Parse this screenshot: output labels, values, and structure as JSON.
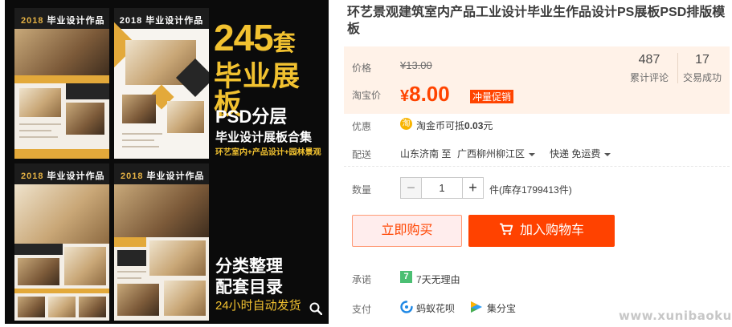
{
  "promo_image": {
    "count": "245",
    "count_unit": "套",
    "headline": "毕业展板",
    "psd": "PSD分层",
    "combo": "毕业设计展板合集",
    "categories": "环艺室内+产品设计+园林景观",
    "sort_line1": "分类整理",
    "sort_line2": "配套目录",
    "shipping": "24小时自动发货",
    "poster_year": "2018",
    "poster_title": "毕业设计作品",
    "poster_title2": "2018 毕业设计作品"
  },
  "product": {
    "title": "环艺景观建筑室内产品工业设计毕业生作品设计PS展板PSD排版模板"
  },
  "price": {
    "label": "价格",
    "original": "¥13.00",
    "promo_label": "淘宝价",
    "currency": "¥",
    "promo_value": "8.00",
    "badge": "冲量促销",
    "reviews_count": "487",
    "reviews_label": "累计评论",
    "sales_count": "17",
    "sales_label": "交易成功"
  },
  "discount": {
    "label": "优惠",
    "coin_char": "淘",
    "text_prefix": "淘金币可抵",
    "amount": "0.03",
    "text_suffix": "元"
  },
  "delivery": {
    "label": "配送",
    "from": "山东济南 至",
    "to": "广西柳州柳江区",
    "method": "快递 免运费"
  },
  "quantity": {
    "label": "数量",
    "minus": "−",
    "value": "1",
    "plus": "+",
    "stock": "件(库存1799413件)"
  },
  "actions": {
    "buy_now": "立即购买",
    "add_to_cart": "加入购物车"
  },
  "promise": {
    "label": "承诺",
    "icon_char": "7",
    "text": "7天无理由"
  },
  "payment": {
    "label": "支付",
    "option1": "蚂蚁花呗",
    "option2": "集分宝"
  },
  "watermark": "www.xunibaoku.com",
  "colors": {
    "accent": "#ff4400",
    "price_bg": "#fff2e8",
    "promo_yellow": "#f2c230",
    "gold": "#e3a93a"
  },
  "icons": [
    "zoom-icon",
    "cart-icon",
    "taobao-coin-icon",
    "seven-day-icon",
    "huabei-icon",
    "jifenbao-icon"
  ]
}
